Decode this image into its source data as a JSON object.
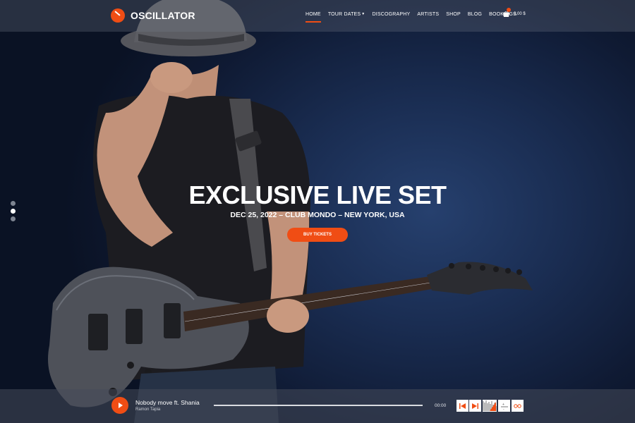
{
  "brand": {
    "name": "OSCILLATOR",
    "accent": "#f04d14"
  },
  "nav": {
    "items": [
      {
        "label": "HOME",
        "active": true
      },
      {
        "label": "TOUR DATES",
        "dropdown": true
      },
      {
        "label": "DISCOGRAPHY"
      },
      {
        "label": "ARTISTS"
      },
      {
        "label": "SHOP"
      },
      {
        "label": "BLOG"
      },
      {
        "label": "BOOKINGS"
      }
    ],
    "cart_total": "0,00 $",
    "cart_icon": "basket-icon"
  },
  "hero": {
    "title": "EXCLUSIVE LIVE SET",
    "subtitle": "DEC 25, 2022 – CLUB MONDO – NEW YORK, USA",
    "button_label": "BUY TICKETS",
    "slide_count": 3,
    "active_slide": 2
  },
  "player": {
    "track_title": "Nobody move ft. Shania",
    "artist": "Ramon Tapia",
    "time": "00:00",
    "progress": 0,
    "icons": [
      "play-icon",
      "previous-icon",
      "next-icon",
      "waveform-icon",
      "volume-icon",
      "loop-icon"
    ]
  }
}
